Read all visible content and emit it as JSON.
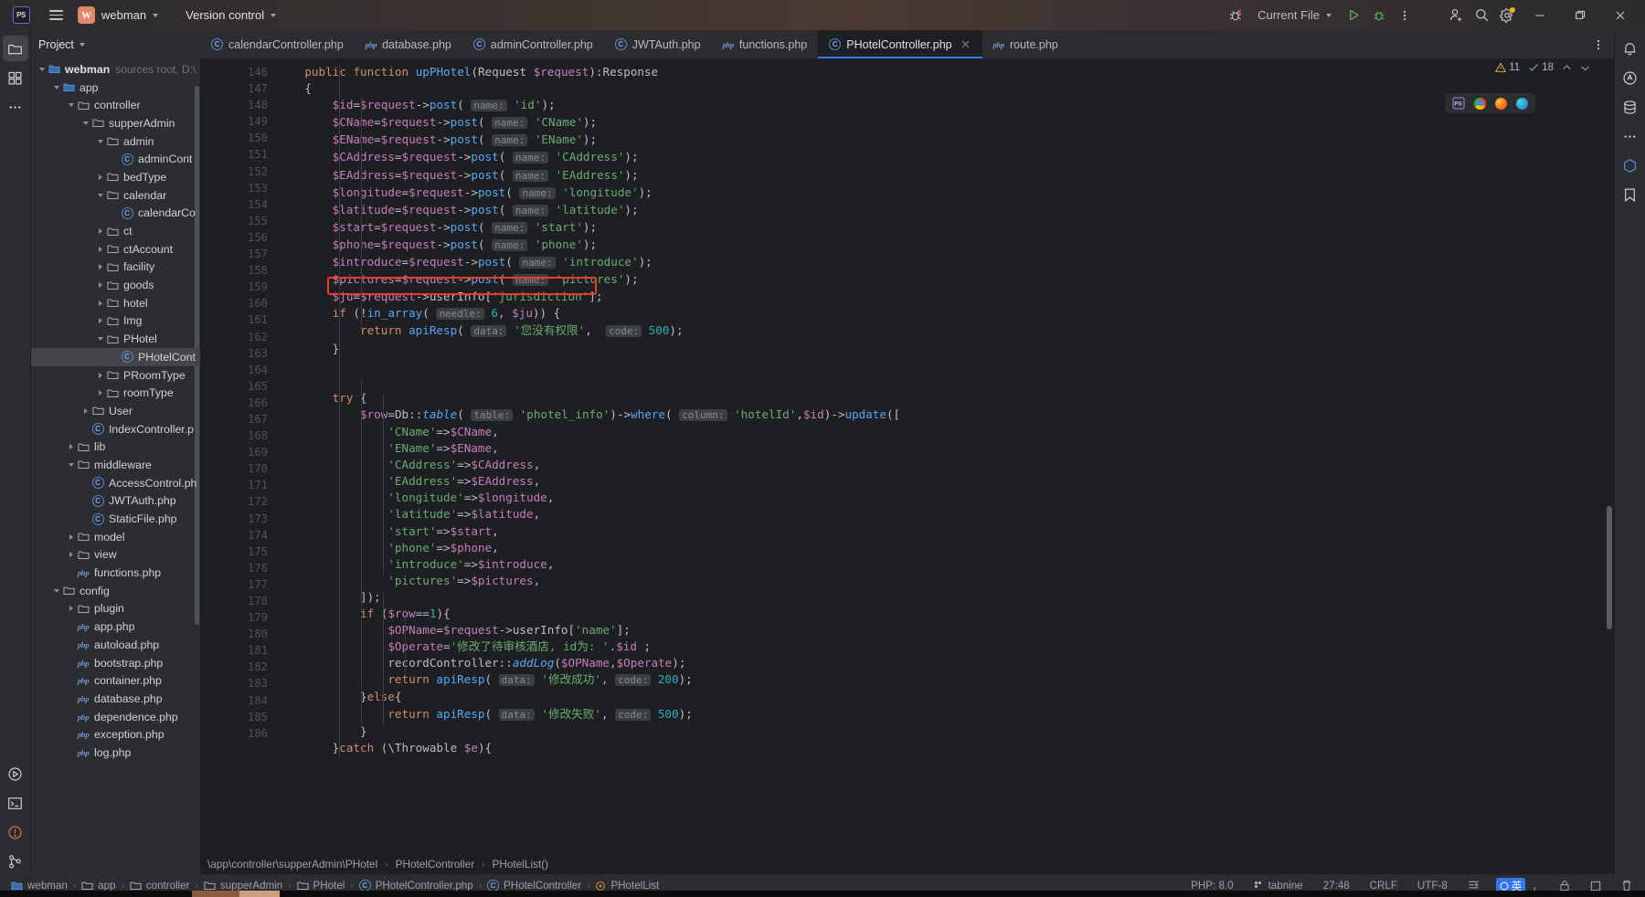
{
  "titlebar": {
    "app_icon": "phpstorm-logo-icon",
    "menu_icon": "hamburger-menu-icon",
    "project_badge": "W",
    "project_name": "webman",
    "version_control_label": "Version control",
    "run_config_label": "Current File",
    "icons": {
      "debug_error": "debug-with-error-icon",
      "run": "run-icon",
      "debug": "debug-icon",
      "more": "more-vertical-icon",
      "add_user": "add-collaborator-icon",
      "search": "search-icon",
      "settings": "settings-gear-icon",
      "minimize": "minimize-icon",
      "maximize": "maximize-restore-icon",
      "close": "close-icon"
    }
  },
  "left_strip": {
    "items": [
      {
        "name": "project-tool-icon",
        "glyph": "folder",
        "active": true
      },
      {
        "name": "commit-tool-icon",
        "glyph": "commit",
        "active": false
      },
      {
        "name": "more-tool-icon",
        "glyph": "ellipsis",
        "active": false
      }
    ],
    "bottom_items": [
      {
        "name": "run-tool-icon",
        "glyph": "run"
      },
      {
        "name": "terminal-tool-icon",
        "glyph": "terminal"
      },
      {
        "name": "problems-tool-icon",
        "glyph": "problems"
      },
      {
        "name": "git-tool-icon",
        "glyph": "git"
      }
    ]
  },
  "right_strip": {
    "items": [
      {
        "name": "notifications-icon",
        "glyph": "bell"
      },
      {
        "name": "ai-assistant-icon",
        "glyph": "ai"
      },
      {
        "name": "database-icon",
        "glyph": "database"
      },
      {
        "name": "more-tool-windows-icon",
        "glyph": "dots"
      },
      {
        "name": "gradle-icon",
        "glyph": "hex"
      },
      {
        "name": "bookmarks-icon",
        "glyph": "flag"
      }
    ]
  },
  "project_panel": {
    "title": "Project",
    "scrollbar": "project-tree-scrollbar",
    "tree": [
      {
        "label": "webman",
        "sub": "sources root, D:\\",
        "icon": "folder-module",
        "indent": 0,
        "arrow": "down",
        "bold": true
      },
      {
        "label": "app",
        "sub": "",
        "icon": "folder-source",
        "indent": 1,
        "arrow": "down",
        "bold": false
      },
      {
        "label": "controller",
        "sub": "",
        "icon": "folder",
        "indent": 2,
        "arrow": "down",
        "bold": false
      },
      {
        "label": "supperAdmin",
        "sub": "",
        "icon": "folder",
        "indent": 3,
        "arrow": "down",
        "bold": false
      },
      {
        "label": "admin",
        "sub": "",
        "icon": "folder",
        "indent": 4,
        "arrow": "down",
        "bold": false
      },
      {
        "label": "adminCont",
        "sub": "",
        "icon": "php-class",
        "indent": 5,
        "arrow": "none",
        "bold": false
      },
      {
        "label": "bedType",
        "sub": "",
        "icon": "folder",
        "indent": 4,
        "arrow": "right",
        "bold": false
      },
      {
        "label": "calendar",
        "sub": "",
        "icon": "folder",
        "indent": 4,
        "arrow": "down",
        "bold": false
      },
      {
        "label": "calendarCo",
        "sub": "",
        "icon": "php-class",
        "indent": 5,
        "arrow": "none",
        "bold": false
      },
      {
        "label": "ct",
        "sub": "",
        "icon": "folder",
        "indent": 4,
        "arrow": "right",
        "bold": false
      },
      {
        "label": "ctAccount",
        "sub": "",
        "icon": "folder",
        "indent": 4,
        "arrow": "right",
        "bold": false
      },
      {
        "label": "facility",
        "sub": "",
        "icon": "folder",
        "indent": 4,
        "arrow": "right",
        "bold": false
      },
      {
        "label": "goods",
        "sub": "",
        "icon": "folder",
        "indent": 4,
        "arrow": "right",
        "bold": false
      },
      {
        "label": "hotel",
        "sub": "",
        "icon": "folder",
        "indent": 4,
        "arrow": "right",
        "bold": false
      },
      {
        "label": "Img",
        "sub": "",
        "icon": "folder",
        "indent": 4,
        "arrow": "right",
        "bold": false
      },
      {
        "label": "PHotel",
        "sub": "",
        "icon": "folder",
        "indent": 4,
        "arrow": "down",
        "bold": false
      },
      {
        "label": "PHotelCont",
        "sub": "",
        "icon": "php-class",
        "indent": 5,
        "arrow": "none",
        "bold": false,
        "selected": true
      },
      {
        "label": "PRoomType",
        "sub": "",
        "icon": "folder",
        "indent": 4,
        "arrow": "right",
        "bold": false
      },
      {
        "label": "roomType",
        "sub": "",
        "icon": "folder",
        "indent": 4,
        "arrow": "right",
        "bold": false
      },
      {
        "label": "User",
        "sub": "",
        "icon": "folder",
        "indent": 3,
        "arrow": "right",
        "bold": false
      },
      {
        "label": "IndexController.p",
        "sub": "",
        "icon": "php-class",
        "indent": 3,
        "arrow": "none",
        "bold": false
      },
      {
        "label": "lib",
        "sub": "",
        "icon": "folder",
        "indent": 2,
        "arrow": "right",
        "bold": false
      },
      {
        "label": "middleware",
        "sub": "",
        "icon": "folder",
        "indent": 2,
        "arrow": "down",
        "bold": false
      },
      {
        "label": "AccessControl.ph",
        "sub": "",
        "icon": "php-class",
        "indent": 3,
        "arrow": "none",
        "bold": false
      },
      {
        "label": "JWTAuth.php",
        "sub": "",
        "icon": "php-class",
        "indent": 3,
        "arrow": "none",
        "bold": false
      },
      {
        "label": "StaticFile.php",
        "sub": "",
        "icon": "php-class",
        "indent": 3,
        "arrow": "none",
        "bold": false
      },
      {
        "label": "model",
        "sub": "",
        "icon": "folder",
        "indent": 2,
        "arrow": "right",
        "bold": false
      },
      {
        "label": "view",
        "sub": "",
        "icon": "folder",
        "indent": 2,
        "arrow": "right",
        "bold": false
      },
      {
        "label": "functions.php",
        "sub": "",
        "icon": "php-file",
        "indent": 2,
        "arrow": "none",
        "bold": false
      },
      {
        "label": "config",
        "sub": "",
        "icon": "folder",
        "indent": 1,
        "arrow": "down",
        "bold": false
      },
      {
        "label": "plugin",
        "sub": "",
        "icon": "folder",
        "indent": 2,
        "arrow": "right",
        "bold": false
      },
      {
        "label": "app.php",
        "sub": "",
        "icon": "php-file",
        "indent": 2,
        "arrow": "none",
        "bold": false
      },
      {
        "label": "autoload.php",
        "sub": "",
        "icon": "php-file",
        "indent": 2,
        "arrow": "none",
        "bold": false
      },
      {
        "label": "bootstrap.php",
        "sub": "",
        "icon": "php-file",
        "indent": 2,
        "arrow": "none",
        "bold": false
      },
      {
        "label": "container.php",
        "sub": "",
        "icon": "php-file",
        "indent": 2,
        "arrow": "none",
        "bold": false
      },
      {
        "label": "database.php",
        "sub": "",
        "icon": "php-file",
        "indent": 2,
        "arrow": "none",
        "bold": false
      },
      {
        "label": "dependence.php",
        "sub": "",
        "icon": "php-file",
        "indent": 2,
        "arrow": "none",
        "bold": false
      },
      {
        "label": "exception.php",
        "sub": "",
        "icon": "php-file",
        "indent": 2,
        "arrow": "none",
        "bold": false
      },
      {
        "label": "log.php",
        "sub": "",
        "icon": "php-file",
        "indent": 2,
        "arrow": "none",
        "bold": false
      }
    ]
  },
  "editor_tabs": [
    {
      "label": "calendarController.php",
      "icon": "php-class",
      "active": false
    },
    {
      "label": "database.php",
      "icon": "php-file",
      "active": false
    },
    {
      "label": "adminController.php",
      "icon": "php-class",
      "active": false
    },
    {
      "label": "JWTAuth.php",
      "icon": "php-class",
      "active": false
    },
    {
      "label": "functions.php",
      "icon": "php-file",
      "active": false
    },
    {
      "label": "PHotelController.php",
      "icon": "php-class",
      "active": true
    },
    {
      "label": "route.php",
      "icon": "php-file",
      "active": false
    }
  ],
  "inspection": {
    "warning_icon": "warning-triangle-icon",
    "warning_count": "11",
    "ok_icon": "checkmark-icon",
    "ok_count": "18",
    "expand_icon": "chevron-up-icon",
    "collapse_icon": "chevron-down-icon"
  },
  "float_toolbar": {
    "ps_icon": "phpstorm-preview-icon",
    "chrome_icon": "chrome-browser-icon",
    "firefox_icon": "firefox-browser-icon",
    "edge_icon": "edge-browser-icon"
  },
  "code": {
    "first_line_number": 146,
    "lines": [
      {
        "n": 146,
        "text": "    public function upPHotel(Request $request):Response"
      },
      {
        "n": 147,
        "text": "    {"
      },
      {
        "n": 148,
        "text": "        $id=$request->post( name: 'id');"
      },
      {
        "n": 149,
        "text": "        $CName=$request->post( name: 'CName');"
      },
      {
        "n": 150,
        "text": "        $EName=$request->post( name: 'EName');"
      },
      {
        "n": 151,
        "text": "        $CAddress=$request->post( name: 'CAddress');"
      },
      {
        "n": 152,
        "text": "        $EAddress=$request->post( name: 'EAddress');"
      },
      {
        "n": 153,
        "text": "        $longitude=$request->post( name: 'longitude');"
      },
      {
        "n": 154,
        "text": "        $latitude=$request->post( name: 'latitude');"
      },
      {
        "n": 155,
        "text": "        $start=$request->post( name: 'start');"
      },
      {
        "n": 156,
        "text": "        $phone=$request->post( name: 'phone');"
      },
      {
        "n": 157,
        "text": "        $introduce=$request->post( name: 'introduce');"
      },
      {
        "n": 158,
        "text": "        $pictures=$request->post( name: 'pictures');"
      },
      {
        "n": 159,
        "text": "        $ju=$request->userInfo['jurisdiction'];"
      },
      {
        "n": 160,
        "text": "        if (!in_array( needle: 6, $ju)) {"
      },
      {
        "n": 161,
        "text": "            return apiResp( data: '您没有权限',  code: 500);"
      },
      {
        "n": 162,
        "text": "        }"
      },
      {
        "n": 163,
        "text": ""
      },
      {
        "n": 164,
        "text": ""
      },
      {
        "n": 165,
        "text": "        try {"
      },
      {
        "n": 166,
        "text": "            $row=Db::table( table: 'photel_info')->where( column: 'hotelId',$id)->update(["
      },
      {
        "n": 167,
        "text": "                'CName'=>$CName,"
      },
      {
        "n": 168,
        "text": "                'EName'=>$EName,"
      },
      {
        "n": 169,
        "text": "                'CAddress'=>$CAddress,"
      },
      {
        "n": 170,
        "text": "                'EAddress'=>$EAddress,"
      },
      {
        "n": 171,
        "text": "                'longitude'=>$longitude,"
      },
      {
        "n": 172,
        "text": "                'latitude'=>$latitude,"
      },
      {
        "n": 173,
        "text": "                'start'=>$start,"
      },
      {
        "n": 174,
        "text": "                'phone'=>$phone,"
      },
      {
        "n": 175,
        "text": "                'introduce'=>$introduce,"
      },
      {
        "n": 176,
        "text": "                'pictures'=>$pictures,"
      },
      {
        "n": 177,
        "text": "            ]);"
      },
      {
        "n": 178,
        "text": "            if ($row==1){"
      },
      {
        "n": 179,
        "text": "                $OPName=$request->userInfo['name'];"
      },
      {
        "n": 180,
        "text": "                $Operate='修改了待审核酒店, id为: '.$id ;"
      },
      {
        "n": 181,
        "text": "                recordController::addLog($OPName,$Operate);"
      },
      {
        "n": 182,
        "text": "                return apiResp( data: '修改成功', code: 200);"
      },
      {
        "n": 183,
        "text": "            }else{"
      },
      {
        "n": 184,
        "text": "                return apiResp( data: '修改失败', code: 500);"
      },
      {
        "n": 185,
        "text": "            }"
      },
      {
        "n": 186,
        "text": "        }catch (\\Throwable $e){"
      }
    ],
    "highlight": {
      "line": 159,
      "color": "#f03a2e",
      "name": "red-highlight-box"
    }
  },
  "editor_breadcrumbs": [
    "\\app\\controller\\supperAdmin\\PHotel",
    "PHotelController",
    "PHotelList()"
  ],
  "status_bar": {
    "crumbs": [
      "webman",
      "app",
      "controller",
      "supperAdmin",
      "PHotel",
      "PHotelController.php",
      "PHotelController",
      "PHotelList"
    ],
    "php_version": "PHP: 8.0",
    "tabnine": "tabnine",
    "caret_position": "27:48",
    "line_separator": "CRLF",
    "encoding": "UTF-8",
    "indent_icon": "indent-icon",
    "ime_lang": "英",
    "ime_punct": "，",
    "lock_icon": "lock-icon",
    "readonly_icon": "readonly-icon",
    "trash_icon": "trash-icon"
  }
}
